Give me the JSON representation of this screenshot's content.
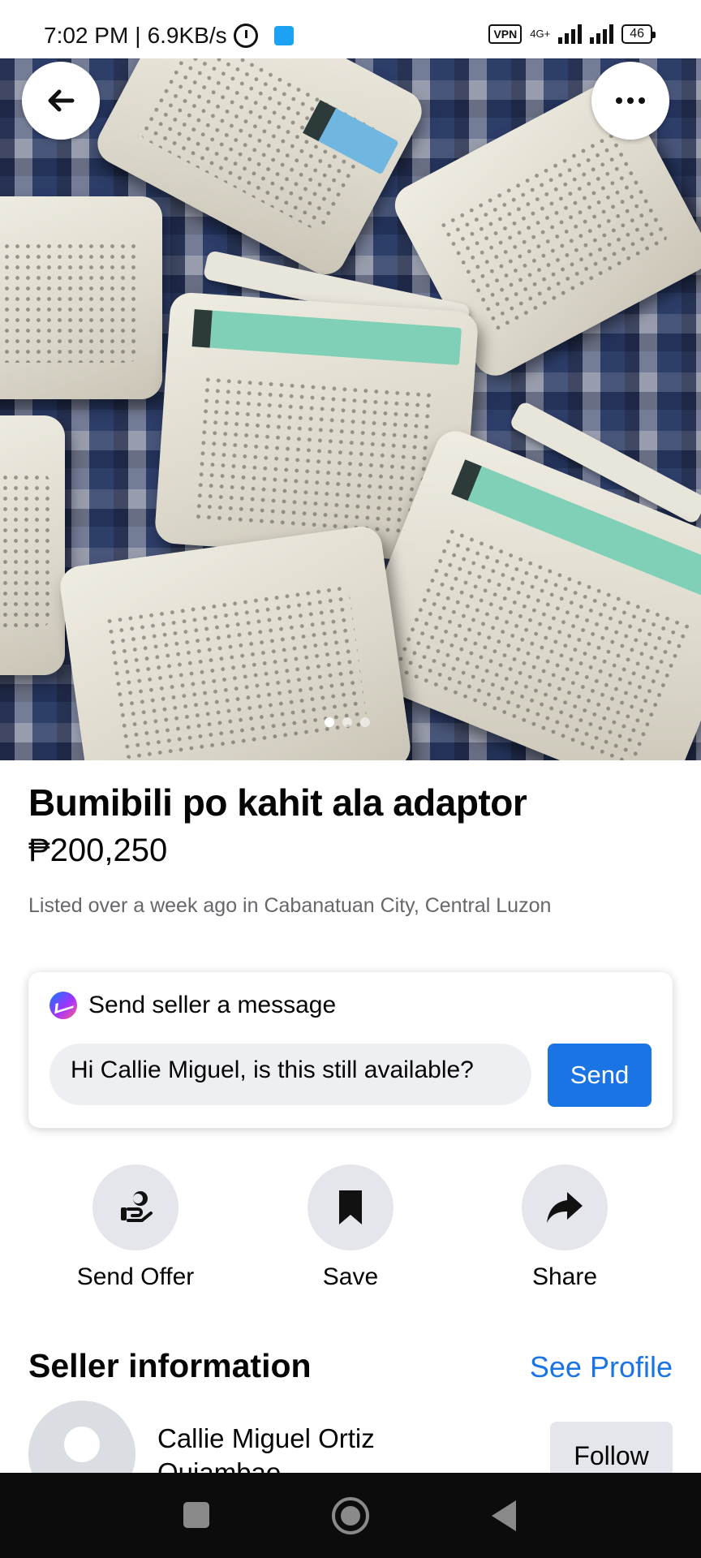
{
  "status_bar": {
    "time": "7:02 PM",
    "speed": "6.9KB/s",
    "vpn": "VPN",
    "network": "4G+",
    "battery": "46"
  },
  "hero": {
    "page_count": 3,
    "active_page": 1
  },
  "listing": {
    "title": "Bumibili po kahit ala adaptor",
    "price": "₱200,250",
    "meta": "Listed over a week ago in Cabanatuan City, Central Luzon"
  },
  "message_card": {
    "header": "Send seller a message",
    "input_value": "Hi Callie Miguel, is this still available?",
    "send_label": "Send"
  },
  "actions": [
    {
      "label": "Send Offer",
      "icon": "send-offer-icon"
    },
    {
      "label": "Save",
      "icon": "bookmark-icon"
    },
    {
      "label": "Share",
      "icon": "share-icon"
    }
  ],
  "seller": {
    "section_title": "Seller information",
    "see_profile": "See Profile",
    "name": "Callie Miguel Ortiz Quiambao",
    "follow_label": "Follow"
  },
  "colors": {
    "accent": "#1b74e4",
    "muted_text": "#65676b",
    "button_bg": "#e4e6eb"
  }
}
